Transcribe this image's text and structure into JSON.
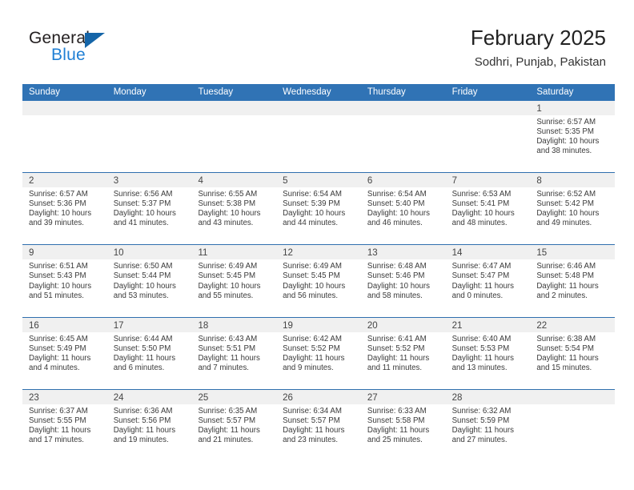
{
  "brand": {
    "word_one": "General",
    "word_two": "Blue",
    "accent_color": "#1565a8",
    "blue_text_color": "#1f7fd4"
  },
  "header": {
    "title": "February 2025",
    "location": "Sodhri, Punjab, Pakistan"
  },
  "calendar": {
    "header_bg": "#3073b5",
    "row_rule_color": "#2f6fae",
    "daynum_band_bg": "#f0f0f0",
    "weekdays": [
      "Sunday",
      "Monday",
      "Tuesday",
      "Wednesday",
      "Thursday",
      "Friday",
      "Saturday"
    ],
    "weeks": [
      [
        {
          "day": ""
        },
        {
          "day": ""
        },
        {
          "day": ""
        },
        {
          "day": ""
        },
        {
          "day": ""
        },
        {
          "day": ""
        },
        {
          "day": "1",
          "sunrise": "Sunrise: 6:57 AM",
          "sunset": "Sunset: 5:35 PM",
          "daylight_line1": "Daylight: 10 hours",
          "daylight_line2": "and 38 minutes."
        }
      ],
      [
        {
          "day": "2",
          "sunrise": "Sunrise: 6:57 AM",
          "sunset": "Sunset: 5:36 PM",
          "daylight_line1": "Daylight: 10 hours",
          "daylight_line2": "and 39 minutes."
        },
        {
          "day": "3",
          "sunrise": "Sunrise: 6:56 AM",
          "sunset": "Sunset: 5:37 PM",
          "daylight_line1": "Daylight: 10 hours",
          "daylight_line2": "and 41 minutes."
        },
        {
          "day": "4",
          "sunrise": "Sunrise: 6:55 AM",
          "sunset": "Sunset: 5:38 PM",
          "daylight_line1": "Daylight: 10 hours",
          "daylight_line2": "and 43 minutes."
        },
        {
          "day": "5",
          "sunrise": "Sunrise: 6:54 AM",
          "sunset": "Sunset: 5:39 PM",
          "daylight_line1": "Daylight: 10 hours",
          "daylight_line2": "and 44 minutes."
        },
        {
          "day": "6",
          "sunrise": "Sunrise: 6:54 AM",
          "sunset": "Sunset: 5:40 PM",
          "daylight_line1": "Daylight: 10 hours",
          "daylight_line2": "and 46 minutes."
        },
        {
          "day": "7",
          "sunrise": "Sunrise: 6:53 AM",
          "sunset": "Sunset: 5:41 PM",
          "daylight_line1": "Daylight: 10 hours",
          "daylight_line2": "and 48 minutes."
        },
        {
          "day": "8",
          "sunrise": "Sunrise: 6:52 AM",
          "sunset": "Sunset: 5:42 PM",
          "daylight_line1": "Daylight: 10 hours",
          "daylight_line2": "and 49 minutes."
        }
      ],
      [
        {
          "day": "9",
          "sunrise": "Sunrise: 6:51 AM",
          "sunset": "Sunset: 5:43 PM",
          "daylight_line1": "Daylight: 10 hours",
          "daylight_line2": "and 51 minutes."
        },
        {
          "day": "10",
          "sunrise": "Sunrise: 6:50 AM",
          "sunset": "Sunset: 5:44 PM",
          "daylight_line1": "Daylight: 10 hours",
          "daylight_line2": "and 53 minutes."
        },
        {
          "day": "11",
          "sunrise": "Sunrise: 6:49 AM",
          "sunset": "Sunset: 5:45 PM",
          "daylight_line1": "Daylight: 10 hours",
          "daylight_line2": "and 55 minutes."
        },
        {
          "day": "12",
          "sunrise": "Sunrise: 6:49 AM",
          "sunset": "Sunset: 5:45 PM",
          "daylight_line1": "Daylight: 10 hours",
          "daylight_line2": "and 56 minutes."
        },
        {
          "day": "13",
          "sunrise": "Sunrise: 6:48 AM",
          "sunset": "Sunset: 5:46 PM",
          "daylight_line1": "Daylight: 10 hours",
          "daylight_line2": "and 58 minutes."
        },
        {
          "day": "14",
          "sunrise": "Sunrise: 6:47 AM",
          "sunset": "Sunset: 5:47 PM",
          "daylight_line1": "Daylight: 11 hours",
          "daylight_line2": "and 0 minutes."
        },
        {
          "day": "15",
          "sunrise": "Sunrise: 6:46 AM",
          "sunset": "Sunset: 5:48 PM",
          "daylight_line1": "Daylight: 11 hours",
          "daylight_line2": "and 2 minutes."
        }
      ],
      [
        {
          "day": "16",
          "sunrise": "Sunrise: 6:45 AM",
          "sunset": "Sunset: 5:49 PM",
          "daylight_line1": "Daylight: 11 hours",
          "daylight_line2": "and 4 minutes."
        },
        {
          "day": "17",
          "sunrise": "Sunrise: 6:44 AM",
          "sunset": "Sunset: 5:50 PM",
          "daylight_line1": "Daylight: 11 hours",
          "daylight_line2": "and 6 minutes."
        },
        {
          "day": "18",
          "sunrise": "Sunrise: 6:43 AM",
          "sunset": "Sunset: 5:51 PM",
          "daylight_line1": "Daylight: 11 hours",
          "daylight_line2": "and 7 minutes."
        },
        {
          "day": "19",
          "sunrise": "Sunrise: 6:42 AM",
          "sunset": "Sunset: 5:52 PM",
          "daylight_line1": "Daylight: 11 hours",
          "daylight_line2": "and 9 minutes."
        },
        {
          "day": "20",
          "sunrise": "Sunrise: 6:41 AM",
          "sunset": "Sunset: 5:52 PM",
          "daylight_line1": "Daylight: 11 hours",
          "daylight_line2": "and 11 minutes."
        },
        {
          "day": "21",
          "sunrise": "Sunrise: 6:40 AM",
          "sunset": "Sunset: 5:53 PM",
          "daylight_line1": "Daylight: 11 hours",
          "daylight_line2": "and 13 minutes."
        },
        {
          "day": "22",
          "sunrise": "Sunrise: 6:38 AM",
          "sunset": "Sunset: 5:54 PM",
          "daylight_line1": "Daylight: 11 hours",
          "daylight_line2": "and 15 minutes."
        }
      ],
      [
        {
          "day": "23",
          "sunrise": "Sunrise: 6:37 AM",
          "sunset": "Sunset: 5:55 PM",
          "daylight_line1": "Daylight: 11 hours",
          "daylight_line2": "and 17 minutes."
        },
        {
          "day": "24",
          "sunrise": "Sunrise: 6:36 AM",
          "sunset": "Sunset: 5:56 PM",
          "daylight_line1": "Daylight: 11 hours",
          "daylight_line2": "and 19 minutes."
        },
        {
          "day": "25",
          "sunrise": "Sunrise: 6:35 AM",
          "sunset": "Sunset: 5:57 PM",
          "daylight_line1": "Daylight: 11 hours",
          "daylight_line2": "and 21 minutes."
        },
        {
          "day": "26",
          "sunrise": "Sunrise: 6:34 AM",
          "sunset": "Sunset: 5:57 PM",
          "daylight_line1": "Daylight: 11 hours",
          "daylight_line2": "and 23 minutes."
        },
        {
          "day": "27",
          "sunrise": "Sunrise: 6:33 AM",
          "sunset": "Sunset: 5:58 PM",
          "daylight_line1": "Daylight: 11 hours",
          "daylight_line2": "and 25 minutes."
        },
        {
          "day": "28",
          "sunrise": "Sunrise: 6:32 AM",
          "sunset": "Sunset: 5:59 PM",
          "daylight_line1": "Daylight: 11 hours",
          "daylight_line2": "and 27 minutes."
        },
        {
          "day": ""
        }
      ]
    ]
  }
}
